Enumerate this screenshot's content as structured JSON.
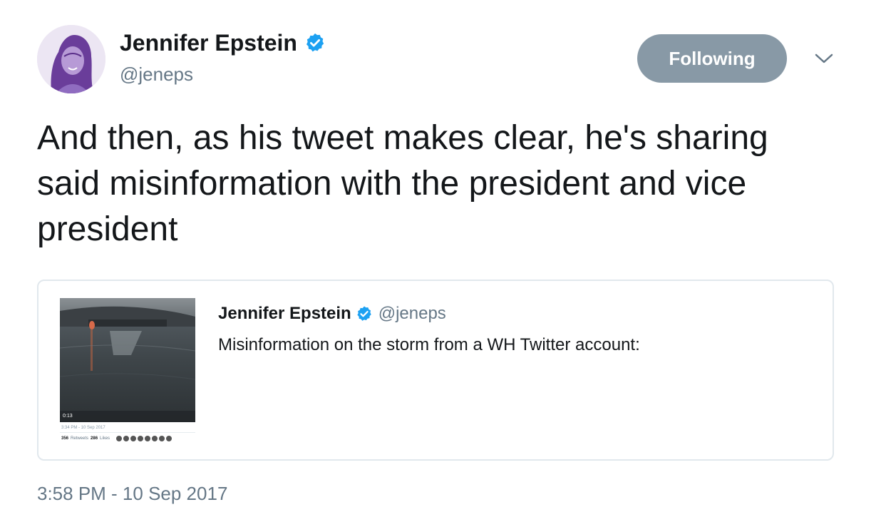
{
  "author": {
    "name": "Jennifer Epstein",
    "handle": "@jeneps",
    "verified": true
  },
  "follow_button": {
    "label": "Following"
  },
  "menu": {
    "icon": "chevron-down-icon"
  },
  "tweet": {
    "text": "And then, as his tweet makes clear, he's sharing said misinformation with the president and vice president",
    "timestamp": "3:58 PM - 10 Sep 2017"
  },
  "quoted_tweet": {
    "author_name": "Jennifer Epstein",
    "author_handle": "@jeneps",
    "verified": true,
    "text": "Misinformation on the storm from a WH Twitter account:",
    "thumbnail": {
      "duration": "0:13",
      "date": "3:34 PM - 10 Sep 2017",
      "retweets": "356",
      "retweets_label": "Retweets",
      "likes": "286",
      "likes_label": "Likes"
    }
  },
  "colors": {
    "verified_blue": "#1da1f2",
    "following_button": "#8899a6",
    "secondary_text": "#657786",
    "card_border": "#e1e8ed"
  }
}
